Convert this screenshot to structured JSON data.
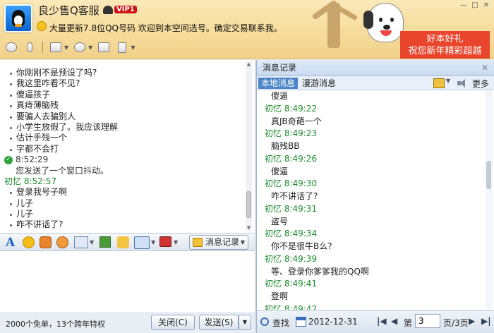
{
  "window": {
    "title": "良少售Q客服",
    "vip_label": "VIP1",
    "status_text": "大量更新7.8位QQ号码  欢迎到本空间选号。确定交易联系我。",
    "promo_line1": "好本好礼",
    "promo_line2": "祝您新年精彩超越"
  },
  "chat": {
    "messages": [
      {
        "kind": "bullet",
        "text": "你刚刚不是预设了吗?"
      },
      {
        "kind": "bullet",
        "text": "我这里咋看不见?"
      },
      {
        "kind": "bullet",
        "text": "傻逼孩子"
      },
      {
        "kind": "bullet",
        "text": "真痔薄脑残"
      },
      {
        "kind": "bullet",
        "text": "要骗人去骗别人"
      },
      {
        "kind": "bullet",
        "text": "小学生放假了。我应该理解"
      },
      {
        "kind": "bullet",
        "text": "估计手残一个"
      },
      {
        "kind": "bullet",
        "text": "字都不会打"
      },
      {
        "kind": "self",
        "text": "8:52:29"
      },
      {
        "kind": "sys",
        "text": "您发送了一个窗口抖动。"
      },
      {
        "kind": "other",
        "text": "初忆  8:52:57"
      },
      {
        "kind": "bullet",
        "text": "登录我号子啊"
      },
      {
        "kind": "bullet",
        "text": "儿子"
      },
      {
        "kind": "bullet",
        "text": "儿子"
      },
      {
        "kind": "bullet",
        "text": "咋不讲话了?"
      }
    ]
  },
  "format_bar": {
    "message_record_label": "消息记录"
  },
  "bottom": {
    "promo_text": "2000个免单，13个跨年特权",
    "close_label": "关闭(C)",
    "send_label": "发送(S)"
  },
  "history": {
    "header_title": "消息记录",
    "tab_local": "本地消息",
    "tab_roaming": "漫游消息",
    "more_label": "更多",
    "lines": [
      {
        "kind": "m",
        "text": "傻逼"
      },
      {
        "kind": "h",
        "text": "初忆  8:49:22"
      },
      {
        "kind": "m",
        "text": "真JB奇葩一个"
      },
      {
        "kind": "h",
        "text": "初忆  8:49:23"
      },
      {
        "kind": "m",
        "text": "脑残BB"
      },
      {
        "kind": "h",
        "text": "初忆  8:49:26"
      },
      {
        "kind": "m",
        "text": "傻逼"
      },
      {
        "kind": "h",
        "text": "初忆  8:49:30"
      },
      {
        "kind": "m",
        "text": "咋不讲话了?"
      },
      {
        "kind": "h",
        "text": "初忆  8:49:31"
      },
      {
        "kind": "m",
        "text": "盗号"
      },
      {
        "kind": "h",
        "text": "初忆  8:49:34"
      },
      {
        "kind": "m",
        "text": "你不是很牛B么?"
      },
      {
        "kind": "h",
        "text": "初忆  8:49:39"
      },
      {
        "kind": "m",
        "text": "等、登录你爹爹我的QQ啊"
      },
      {
        "kind": "h",
        "text": "初忆  8:49:41"
      },
      {
        "kind": "m",
        "text": "登啊"
      },
      {
        "kind": "h",
        "text": "初忆  8:49:42"
      }
    ],
    "find_label": "查找",
    "date_label": "2012-12-31",
    "page_prefix": "第",
    "page_value": "3",
    "page_total": "页/3页"
  }
}
